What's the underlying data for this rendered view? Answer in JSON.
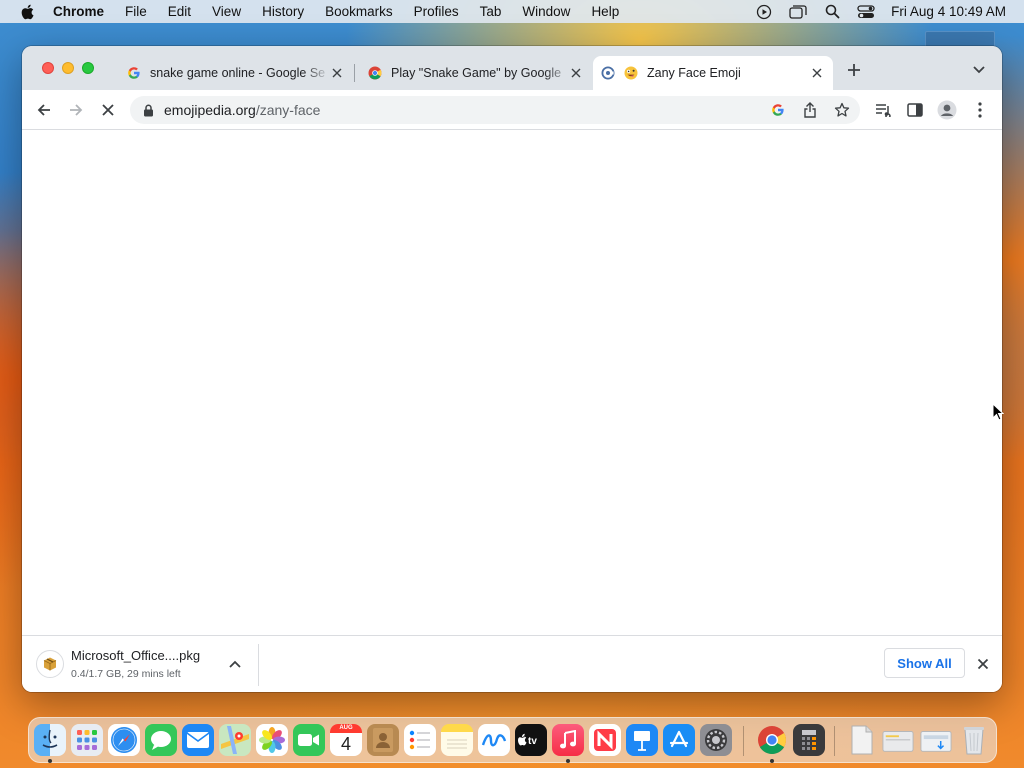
{
  "menubar": {
    "app_name": "Chrome",
    "items": [
      "File",
      "Edit",
      "View",
      "History",
      "Bookmarks",
      "Profiles",
      "Tab",
      "Window",
      "Help"
    ],
    "clock": "Fri Aug 4  10:49 AM"
  },
  "tabs": [
    {
      "title": "snake game online - Google Se",
      "favicon": "google-g-icon",
      "active": false
    },
    {
      "title": "Play \"Snake Game\" by Google",
      "favicon": "chrome-icon",
      "active": false
    },
    {
      "title": "Zany Face Emoji",
      "favicon": "emojipedia-icon",
      "active": true
    }
  ],
  "omnibox": {
    "url_domain": "emojipedia.org",
    "url_path": "/zany-face"
  },
  "download": {
    "filename": "Microsoft_Office....pkg",
    "status": "0.4/1.7 GB, 29 mins left",
    "show_all_label": "Show All"
  },
  "dock": {
    "calendar_month": "AUG",
    "calendar_day": "4",
    "apps": [
      "finder-icon",
      "launchpad-icon",
      "safari-icon",
      "messages-icon",
      "mail-icon",
      "maps-icon",
      "photos-icon",
      "facetime-icon",
      "calendar-icon",
      "contacts-icon",
      "reminders-icon",
      "notes-icon",
      "freeform-icon",
      "appletv-icon",
      "music-icon",
      "news-icon",
      "keynote-icon",
      "appstore-icon",
      "system-settings-icon",
      "chrome-icon",
      "calculator-icon",
      "document-icon",
      "folder-icon",
      "downloads-icon",
      "trash-icon"
    ]
  },
  "colors": {
    "accent": "#1a73e8",
    "tabstrip": "#dee3e8"
  }
}
